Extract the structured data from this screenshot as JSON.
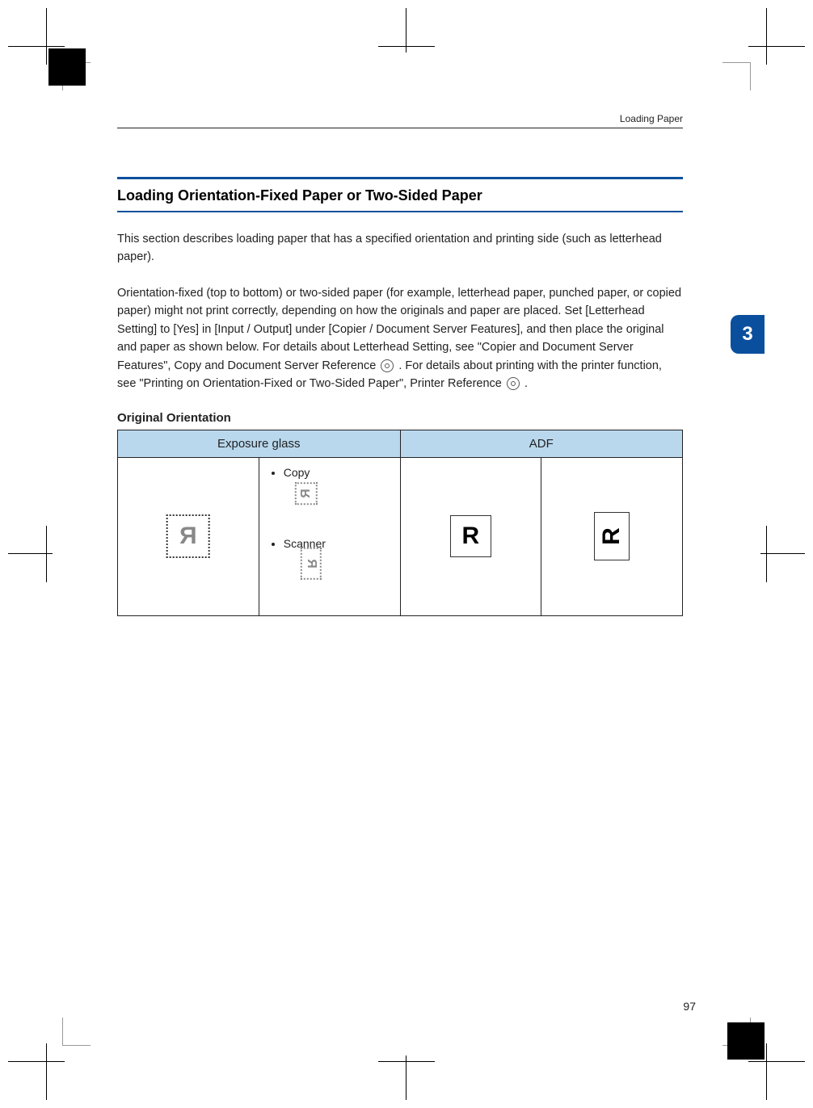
{
  "running_head": "Loading Paper",
  "chapter_number": "3",
  "page_number": "97",
  "section_heading": "Loading Orientation-Fixed Paper or Two-Sided Paper",
  "paragraphs": {
    "p1": "This section describes loading paper that has a specified orientation and printing side (such as letterhead paper).",
    "p2_part1": "Orientation-fixed (top to bottom) or two-sided paper (for example, letterhead paper, punched paper, or copied paper) might not print correctly, depending on how the originals and paper are placed. Set [Letterhead Setting] to [Yes] in [Input / Output] under [Copier / Document Server Features], and then place the original and paper as shown below. For details about Letterhead Setting, see \"Copier and Document Server Features\", Copy and Document Server Reference",
    "p2_part2": ". For details about printing with the printer function, see \"Printing on Orientation-Fixed or Two-Sided Paper\", Printer Reference",
    "p2_part3": "."
  },
  "subhead": "Original Orientation",
  "table": {
    "header_exposure": "Exposure glass",
    "header_adf": "ADF",
    "exposure_glyph": "R",
    "copy_label": "Copy",
    "scanner_label": "Scanner",
    "copy_glyph": "R",
    "scanner_glyph": "R",
    "adf_glyph_1": "R",
    "adf_glyph_2": "R"
  },
  "icons": {
    "cd_ref": "cd-reference-icon"
  }
}
